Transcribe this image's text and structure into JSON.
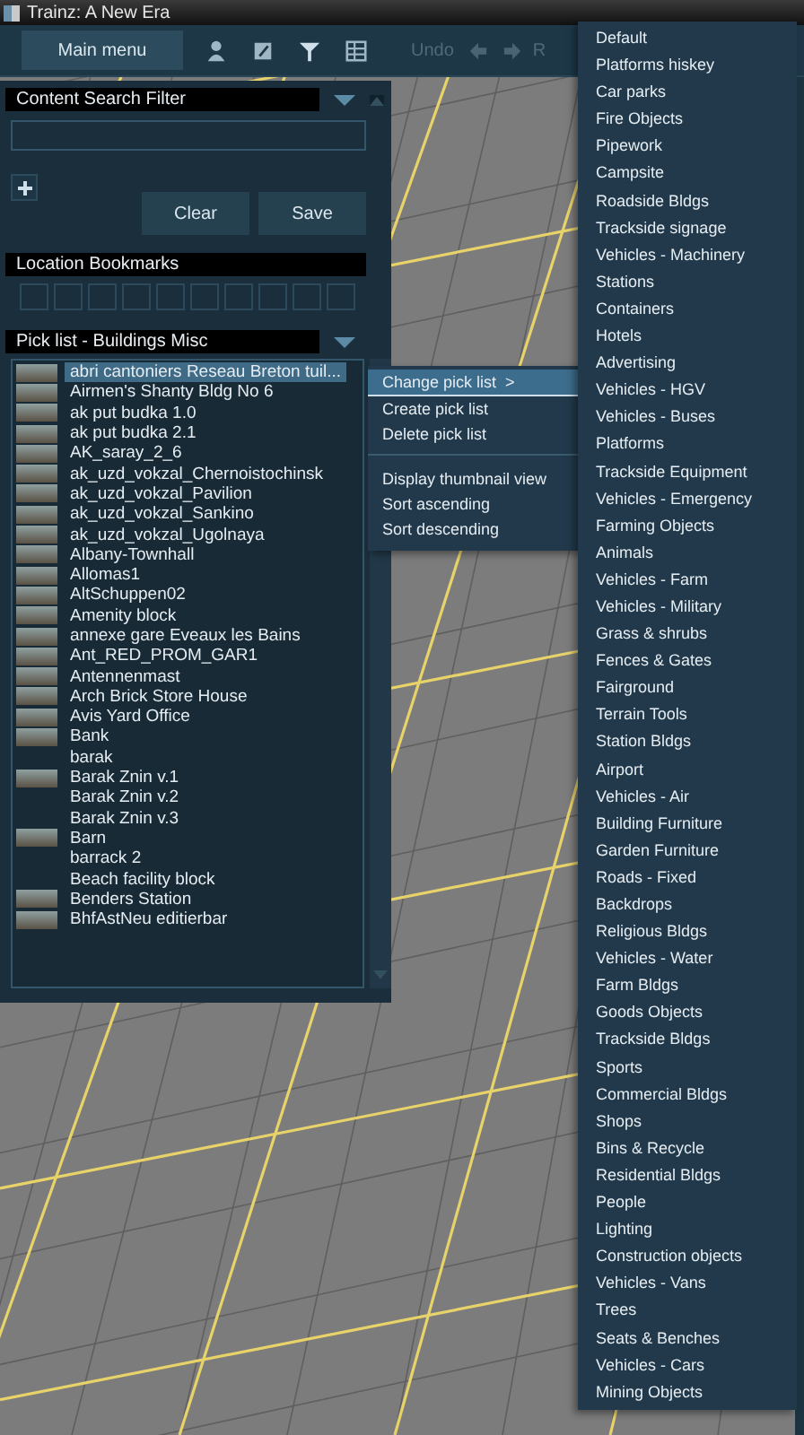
{
  "window": {
    "title": "Trainz: A New Era"
  },
  "toolbar": {
    "main_menu": "Main menu",
    "undo": "Undo",
    "redo": "R"
  },
  "search_filter": {
    "title": "Content Search Filter",
    "buttons": [
      "Clear",
      "Save"
    ]
  },
  "bookmarks": {
    "title": "Location Bookmarks"
  },
  "pick_list": {
    "title": "Pick list - Buildings Misc",
    "items": [
      {
        "name": "abri cantoniers Reseau Breton tuil...",
        "thumbnail": true,
        "selected": true
      },
      {
        "name": "Airmen's Shanty Bldg No 6",
        "thumbnail": true,
        "selected": false
      },
      {
        "name": "ak put budka 1.0",
        "thumbnail": true,
        "selected": false
      },
      {
        "name": "ak put budka 2.1",
        "thumbnail": true,
        "selected": false
      },
      {
        "name": "AK_saray_2_6",
        "thumbnail": true,
        "selected": false
      },
      {
        "name": "ak_uzd_vokzal_Chernoistochinsk",
        "thumbnail": true,
        "selected": false
      },
      {
        "name": "ak_uzd_vokzal_Pavilion",
        "thumbnail": true,
        "selected": false
      },
      {
        "name": "ak_uzd_vokzal_Sankino",
        "thumbnail": true,
        "selected": false
      },
      {
        "name": "ak_uzd_vokzal_Ugolnaya",
        "thumbnail": true,
        "selected": false
      },
      {
        "name": "Albany-Townhall",
        "thumbnail": true,
        "selected": false
      },
      {
        "name": "Allomas1",
        "thumbnail": true,
        "selected": false
      },
      {
        "name": "AltSchuppen02",
        "thumbnail": true,
        "selected": false
      },
      {
        "name": "Amenity block",
        "thumbnail": true,
        "selected": false
      },
      {
        "name": "annexe gare Eveaux les Bains",
        "thumbnail": true,
        "selected": false
      },
      {
        "name": "Ant_RED_PROM_GAR1",
        "thumbnail": true,
        "selected": false
      },
      {
        "name": "Antennenmast",
        "thumbnail": true,
        "selected": false
      },
      {
        "name": "Arch Brick Store House",
        "thumbnail": true,
        "selected": false
      },
      {
        "name": "Avis Yard Office",
        "thumbnail": true,
        "selected": false
      },
      {
        "name": "Bank",
        "thumbnail": true,
        "selected": false
      },
      {
        "name": "barak",
        "thumbnail": false,
        "selected": false
      },
      {
        "name": "Barak Znin v.1",
        "thumbnail": true,
        "selected": false
      },
      {
        "name": "Barak Znin v.2",
        "thumbnail": false,
        "selected": false
      },
      {
        "name": "Barak Znin v.3",
        "thumbnail": false,
        "selected": false
      },
      {
        "name": "Barn",
        "thumbnail": true,
        "selected": false
      },
      {
        "name": "barrack 2",
        "thumbnail": false,
        "selected": false
      },
      {
        "name": "Beach facility block",
        "thumbnail": false,
        "selected": false
      },
      {
        "name": "Benders Station",
        "thumbnail": true,
        "selected": false
      },
      {
        "name": "BhfAstNeu editierbar",
        "thumbnail": true,
        "selected": false
      }
    ]
  },
  "context_menu": {
    "groups": [
      [
        {
          "label": "Change pick list",
          "submenu": ">",
          "selected": true
        },
        {
          "label": "Create pick list",
          "selected": false
        },
        {
          "label": "Delete pick list",
          "selected": false
        }
      ],
      [
        {
          "label": "Display thumbnail view",
          "selected": false
        },
        {
          "label": "Sort ascending",
          "selected": false
        },
        {
          "label": "Sort descending",
          "selected": false
        }
      ]
    ]
  },
  "submenu": {
    "items": [
      "Default",
      "Platforms hiskey",
      "Car parks",
      "Fire Objects",
      "Pipework",
      "Campsite",
      "Roadside Bldgs",
      "Trackside signage",
      "Vehicles - Machinery",
      "Stations",
      "Containers",
      "Hotels",
      "Advertising",
      "Vehicles - HGV",
      "Vehicles - Buses",
      "Platforms",
      "Trackside Equipment",
      "Vehicles - Emergency",
      "Farming Objects",
      "Animals",
      "Vehicles - Farm",
      "Vehicles - Military",
      "Grass & shrubs",
      "Fences & Gates",
      "Fairground",
      "Terrain Tools",
      "Station Bldgs",
      "Airport",
      "Vehicles - Air",
      "Building Furniture",
      "Garden Furniture",
      "Roads - Fixed",
      "Backdrops",
      "Religious Bldgs",
      "Vehicles - Water",
      "Farm Bldgs",
      "Goods Objects",
      "Trackside Bldgs",
      "Sports",
      "Commercial Bldgs",
      "Shops",
      "Bins & Recycle",
      "Residential Bldgs",
      "People",
      "Lighting",
      "Construction objects",
      "Vehicles - Vans",
      "Trees",
      "Seats & Benches",
      "Vehicles - Cars",
      "Mining Objects"
    ]
  }
}
